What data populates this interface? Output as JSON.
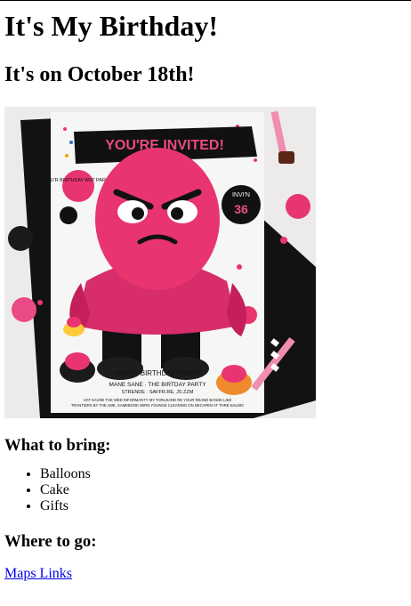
{
  "page": {
    "title": "It's My Birthday!",
    "subtitle": "It's on October 18th!",
    "bring_heading": "What to bring:",
    "bring_items": [
      "Balloons",
      "Cake",
      "Gifts"
    ],
    "where_heading": "Where to go:",
    "maps_link": "Maps Links"
  },
  "poster": {
    "banner": "YOU'RE INVITED!",
    "left_bubble": "YOU'R BIRTHDAY ANT PARTY!",
    "right_badge_top": "INVI'N",
    "right_badge_number": "36",
    "happy_line": "HAPPY BIRTHDAY PARTY",
    "host_line": "MANE SANE · THE BIRTDAY PARTY",
    "address_line": "STRENDE · SAFFR.RE, JS ZZM",
    "fine_print_1": "HAT SAUNE THE WED INFORMANTY MY THRUSAND RE YOUR REAND BANGE LIKE",
    "fine_print_2": "TRANTIERS BY THE AME, SAMEBOOK WIRN YOUNGE CLEANING ON NECAPEN AT THRE NAUSE!",
    "colors": {
      "pink": "#e8356f",
      "dark_pink": "#b8174a",
      "black": "#111111",
      "paper": "#f5f5f3"
    }
  }
}
